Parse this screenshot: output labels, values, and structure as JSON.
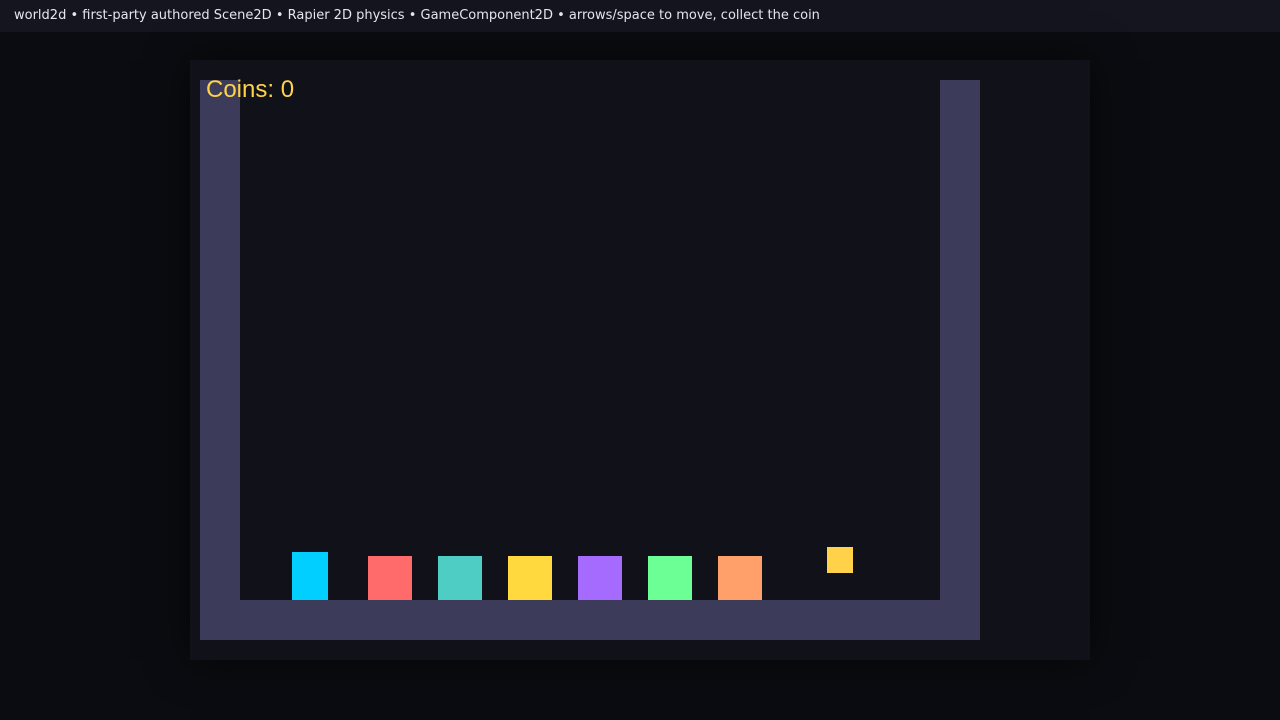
{
  "topbar": {
    "text": "world2d • first-party authored Scene2D • Rapier 2D physics • GameComponent2D • arrows/space to move, collect the coin"
  },
  "hud": {
    "coins_text": "Coins: 0"
  },
  "entities": [
    {
      "name": "player-block",
      "color": "#00cfff"
    },
    {
      "name": "box-red",
      "color": "#ff6b6b"
    },
    {
      "name": "box-teal",
      "color": "#4ecdc4"
    },
    {
      "name": "box-yellow",
      "color": "#ffd93d"
    },
    {
      "name": "box-purple",
      "color": "#a56bff"
    },
    {
      "name": "box-green",
      "color": "#6bff95"
    },
    {
      "name": "box-orange",
      "color": "#ffa06b"
    },
    {
      "name": "coin",
      "color": "#ffd24a"
    }
  ],
  "colors": {
    "background": "#0b0c11",
    "stage": "#11111a",
    "walls": "#3c3c5a",
    "hud_text": "#ffd24a"
  }
}
